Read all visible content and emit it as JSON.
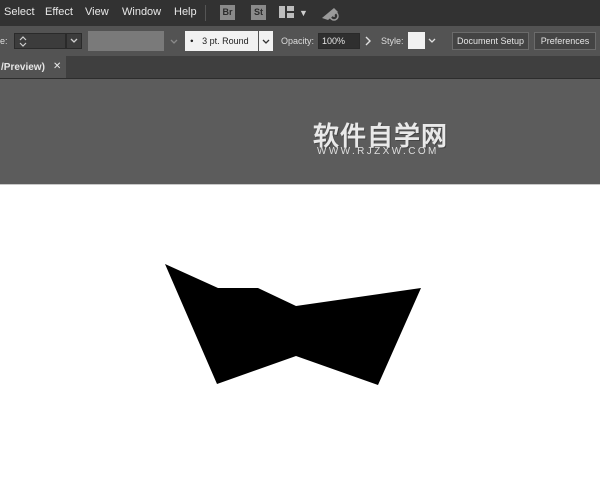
{
  "menubar": {
    "items": [
      "Select",
      "Effect",
      "View",
      "Window",
      "Help"
    ],
    "bridge_label": "Br",
    "stock_label": "St"
  },
  "control_bar": {
    "stroke_label_fragment": "e:",
    "brush_value": "3 pt. Round",
    "opacity_label": "Opacity:",
    "opacity_value": "100%",
    "style_label": "Style:",
    "document_setup_label": "Document Setup",
    "preferences_label": "Preferences"
  },
  "tab": {
    "title": "/Preview)",
    "close_glyph": "✕"
  },
  "watermark": {
    "main": "软件自学网",
    "sub": "WWW.RJZXW.COM"
  },
  "colors": {
    "menubar_bg": "#323232",
    "control_bg": "#535353",
    "pasteboard_bg": "#5c5c5c",
    "shape_fill": "#000000"
  }
}
